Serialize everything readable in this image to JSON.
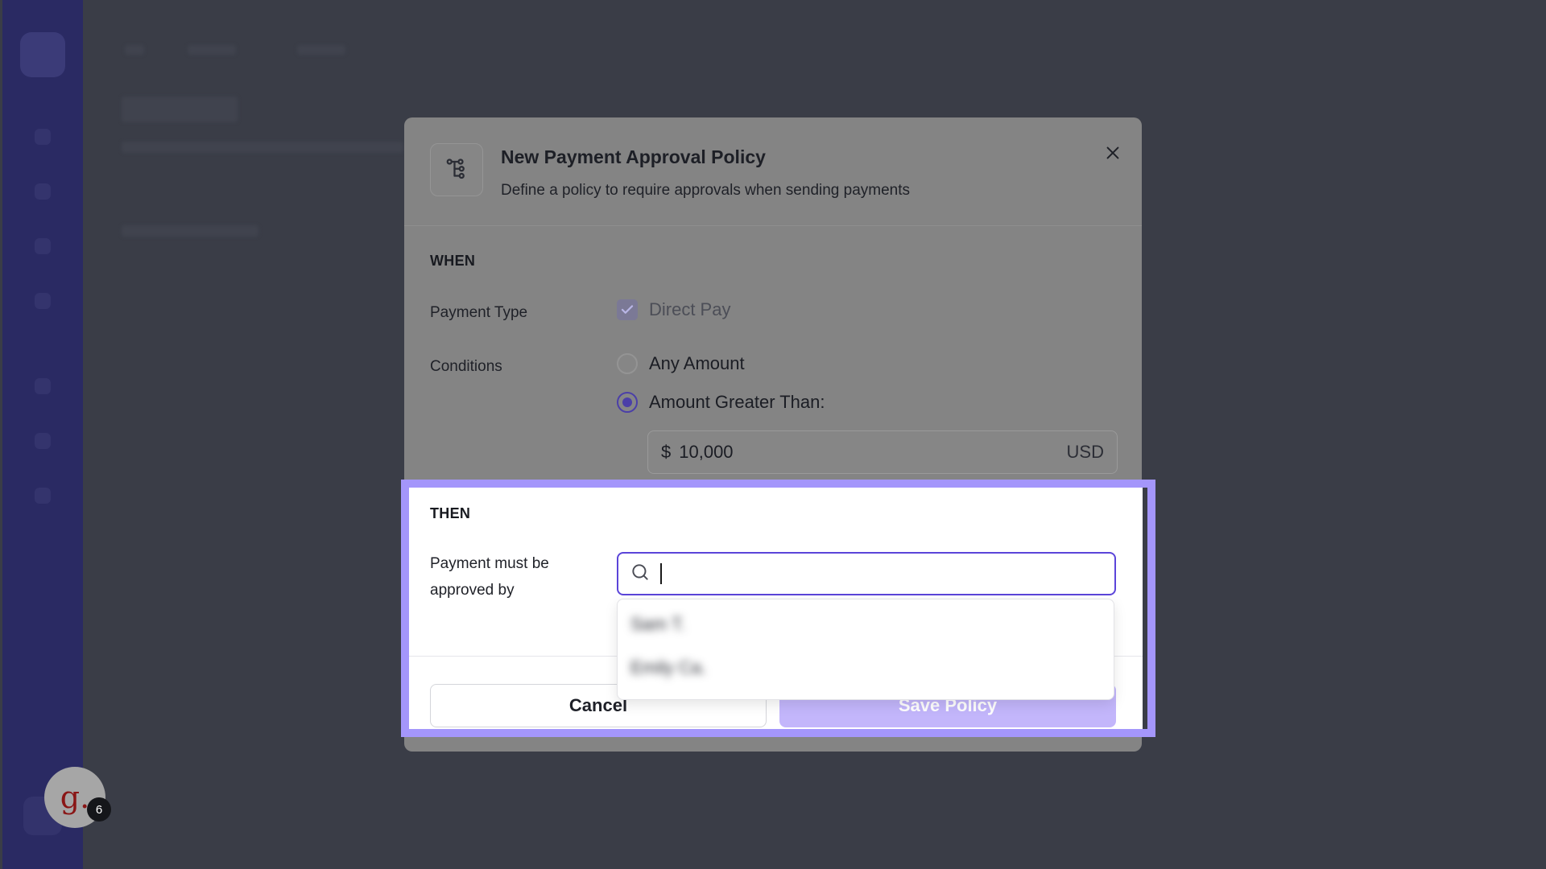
{
  "modal": {
    "title": "New Payment Approval Policy",
    "subtitle": "Define a policy to require approvals when sending payments",
    "header_icon": "workflow-tree-icon",
    "close_icon": "close-icon"
  },
  "when": {
    "title": "WHEN",
    "payment_type_label": "Payment Type",
    "payment_type_option": {
      "label": "Direct Pay",
      "checked": true,
      "disabled": true
    },
    "conditions_label": "Conditions",
    "conditions_options": [
      {
        "label": "Any Amount",
        "selected": false
      },
      {
        "label": "Amount Greater Than:",
        "selected": true
      }
    ],
    "amount": {
      "symbol": "$",
      "value": "10,000",
      "currency": "USD"
    }
  },
  "then": {
    "title": "THEN",
    "approver_label_line1": "Payment must be",
    "approver_label_line2": "approved by",
    "search": {
      "icon": "search-icon",
      "value": ""
    },
    "dropdown_items": [
      "Sam T.",
      "Emily Ca."
    ]
  },
  "footer": {
    "cancel_label": "Cancel",
    "save_label": "Save Policy"
  },
  "avatar": {
    "letter": "g.",
    "badge_count": "6"
  },
  "colors": {
    "highlight": "#a496fb",
    "accent": "#5b45d9",
    "save_button_disabled": "#c3b6fb",
    "overlay": "#3a3d47"
  }
}
